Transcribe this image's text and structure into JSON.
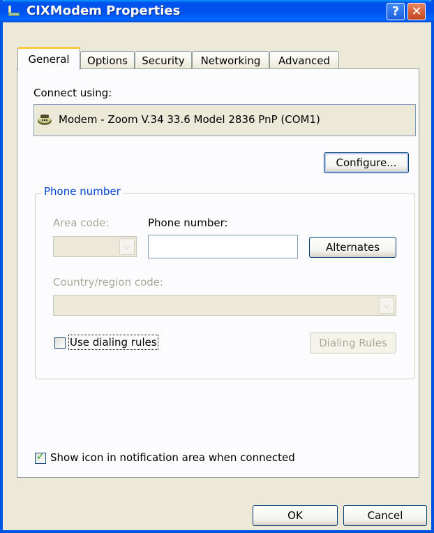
{
  "window": {
    "title": "CIXModem Properties",
    "help_label": "?",
    "close_label": "✕"
  },
  "tabs": [
    "General",
    "Options",
    "Security",
    "Networking",
    "Advanced"
  ],
  "active_tab": "General",
  "connect_using": {
    "label": "Connect using:",
    "device": "Modem - Zoom V.34 33.6 Model 2836 PnP (COM1)",
    "configure_label": "Configure..."
  },
  "phone": {
    "group_title": "Phone number",
    "area_code_label": "Area code:",
    "area_code_value": "",
    "phone_number_label": "Phone number:",
    "phone_number_value": "",
    "alternates_label": "Alternates",
    "country_label": "Country/region code:",
    "country_value": "",
    "use_dialing_rules_label": "Use dialing rules",
    "use_dialing_rules_checked": false,
    "dialing_rules_label": "Dialing Rules"
  },
  "show_icon": {
    "label": "Show icon in notification area when connected",
    "checked": true
  },
  "footer": {
    "ok_label": "OK",
    "cancel_label": "Cancel"
  },
  "colors": {
    "title_bar": "#0054e3",
    "dialog_bg": "#ece9d8",
    "group_title": "#0046d5",
    "tab_highlight": "#ffc83c"
  }
}
